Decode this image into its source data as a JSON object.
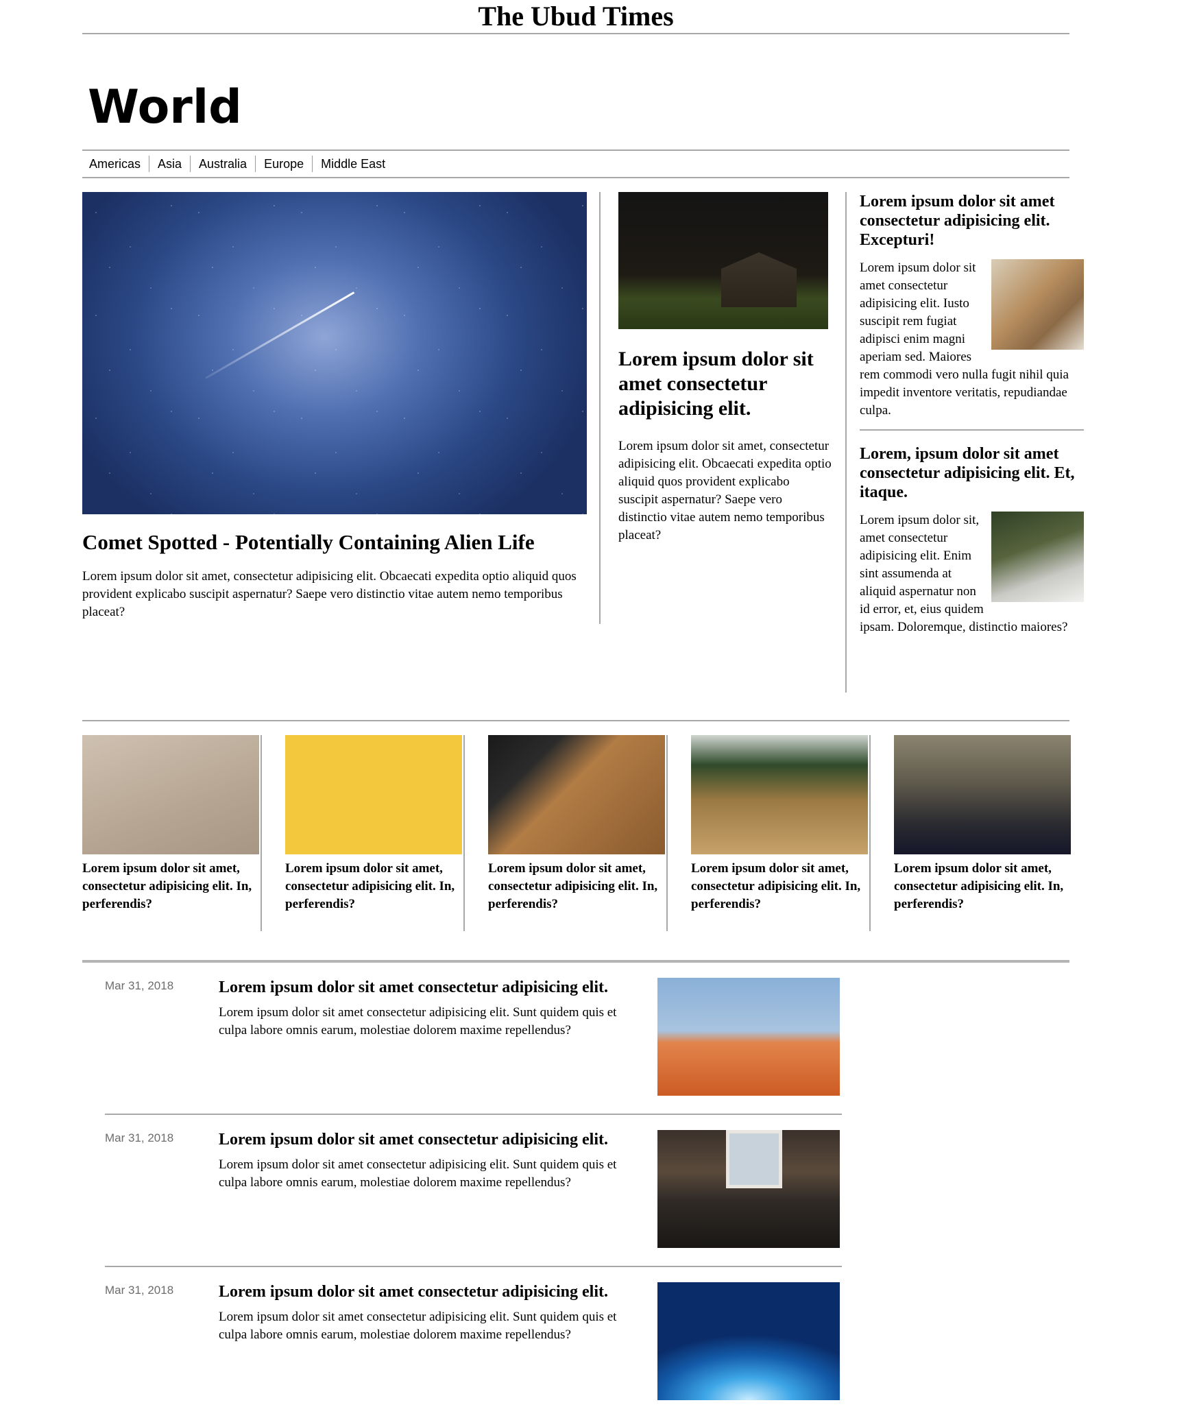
{
  "masthead": {
    "title": "The Ubud Times"
  },
  "section": {
    "title": "World"
  },
  "subnav": {
    "items": [
      "Americas",
      "Asia",
      "Australia",
      "Europe",
      "Middle East"
    ]
  },
  "lead": {
    "headline": "Comet Spotted - Potentially Containing Alien Life",
    "summary": "Lorem ipsum dolor sit amet, consectetur adipisicing elit. Obcaecati expedita optio aliquid quos provident explicabo suscipit aspernatur? Saepe vero distinctio vitae autem nemo temporibus placeat?"
  },
  "middle": {
    "headline": "Lorem ipsum dolor sit amet consectetur adipisicing elit.",
    "summary": "Lorem ipsum dolor sit amet, consectetur adipisicing elit. Obcaecati expedita optio aliquid quos provident explicabo suscipit aspernatur? Saepe vero distinctio vitae autem nemo temporibus placeat?"
  },
  "side": [
    {
      "headline": "Lorem ipsum dolor sit amet consectetur adipisicing elit. Excepturi!",
      "body": "Lorem ipsum dolor sit amet consectetur adipisicing elit. Iusto suscipit rem fugiat adipisci enim magni aperiam sed. Maiores rem commodi vero nulla fugit nihil quia impedit inventore veritatis, repudiandae culpa."
    },
    {
      "headline": "Lorem, ipsum dolor sit amet consectetur adipisicing elit. Et, itaque.",
      "body": "Lorem ipsum dolor sit, amet consectetur adipisicing elit. Enim sint assumenda at aliquid aspernatur non id error, et, eius quidem ipsam. Doloremque, distinctio maiores?"
    }
  ],
  "cards": [
    {
      "title": "Lorem ipsum dolor sit amet, consectetur adipisicing elit. In, perferendis?"
    },
    {
      "title": "Lorem ipsum dolor sit amet, consectetur adipisicing elit. In, perferendis?"
    },
    {
      "title": "Lorem ipsum dolor sit amet, consectetur adipisicing elit. In, perferendis?"
    },
    {
      "title": "Lorem ipsum dolor sit amet, consectetur adipisicing elit. In, perferendis?"
    },
    {
      "title": "Lorem ipsum dolor sit amet, consectetur adipisicing elit. In, perferendis?"
    }
  ],
  "list": [
    {
      "date": "Mar 31, 2018",
      "headline": "Lorem ipsum dolor sit amet consectetur adipisicing elit.",
      "summary": "Lorem ipsum dolor sit amet consectetur adipisicing elit. Sunt quidem quis et culpa labore omnis earum, molestiae dolorem maxime repellendus?"
    },
    {
      "date": "Mar 31, 2018",
      "headline": "Lorem ipsum dolor sit amet consectetur adipisicing elit.",
      "summary": "Lorem ipsum dolor sit amet consectetur adipisicing elit. Sunt quidem quis et culpa labore omnis earum, molestiae dolorem maxime repellendus?"
    },
    {
      "date": "Mar 31, 2018",
      "headline": "Lorem ipsum dolor sit amet consectetur adipisicing elit.",
      "summary": "Lorem ipsum dolor sit amet consectetur adipisicing elit. Sunt quidem quis et culpa labore omnis earum, molestiae dolorem maxime repellendus?"
    }
  ]
}
